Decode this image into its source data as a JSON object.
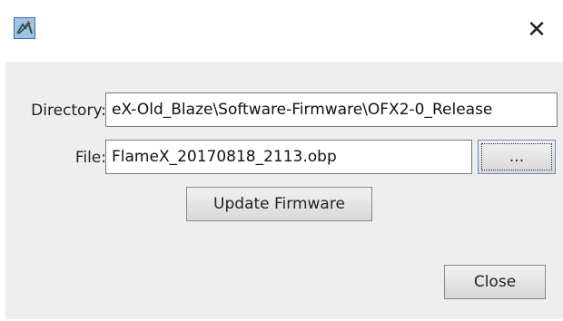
{
  "window": {
    "app_icon": "app-logo-icon",
    "close_glyph": "✕"
  },
  "form": {
    "directory_label": "Directory:",
    "directory_value": "eX-Old_Blaze\\Software-Firmware\\OFX2-0_Release",
    "file_label": "File:",
    "file_value": "FlameX_20170818_2113.obp",
    "browse_label": "...",
    "update_label": "Update Firmware",
    "close_label": "Close"
  }
}
